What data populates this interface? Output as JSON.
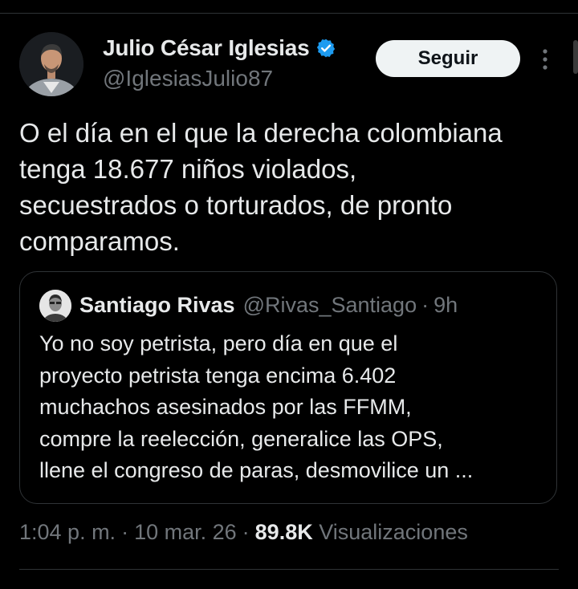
{
  "author": {
    "display_name": "Julio César Iglesias",
    "handle": "@IglesiasJulio87",
    "verified": true
  },
  "actions": {
    "follow_label": "Seguir",
    "more_icon": "more-vertical-icon"
  },
  "tweet": {
    "text": "O el día en el que la derecha colombiana\ntenga 18.677 niños violados,\nsecuestrados o torturados, de pronto\ncomparamos."
  },
  "quoted_tweet": {
    "display_name": "Santiago Rivas",
    "handle": "@Rivas_Santiago",
    "separator": "·",
    "time": "9h",
    "text": "Yo no soy petrista, pero día en que el\nproyecto petrista tenga encima 6.402\nmuchachos asesinados por las FFMM,\ncompre la reelección, generalice las OPS,\nllene el congreso de paras, desmovilice un ..."
  },
  "meta": {
    "time": "1:04 p. m.",
    "date": "10 mar. 26",
    "separator": "·",
    "views_count": "89.8K",
    "views_label": "Visualizaciones"
  },
  "colors": {
    "background": "#000000",
    "text_primary": "#e7e9ea",
    "text_secondary": "#71767b",
    "border": "#2f3336",
    "verified_blue": "#1d9bf0",
    "button_bg": "#eff3f4"
  }
}
